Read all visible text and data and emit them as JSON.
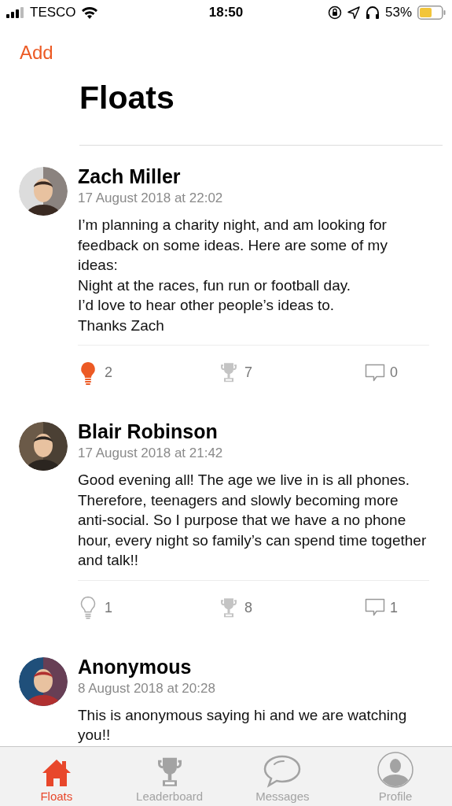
{
  "status_bar": {
    "carrier": "TESCO",
    "time": "18:50",
    "battery": "53%"
  },
  "nav": {
    "add": "Add"
  },
  "title": "Floats",
  "posts": [
    {
      "name": "Zach Miller",
      "date": "17 August 2018 at 22:02",
      "text": "I’m planning a charity night, and am looking for feedback on some ideas. Here are some of my ideas:\nNight at the races, fun run or football day.\nI’d love to hear other people’s ideas to.\nThanks Zach",
      "liked": true,
      "likes": "2",
      "trophies": "7",
      "comments": "0"
    },
    {
      "name": "Blair Robinson",
      "date": "17 August 2018 at 21:42",
      "text": "Good evening all! The age we live in is all phones. Therefore, teenagers and slowly becoming more anti-social. So I purpose that we have a no phone hour, every night so family’s can spend time together and talk!!",
      "liked": false,
      "likes": "1",
      "trophies": "8",
      "comments": "1"
    },
    {
      "name": "Anonymous",
      "date": "8 August 2018 at 20:28",
      "text": "This is anonymous saying hi and we are watching you!!"
    }
  ],
  "tabs": [
    {
      "kind": "home",
      "label": "Floats",
      "selected": true
    },
    {
      "kind": "trophy",
      "label": "Leaderboard",
      "selected": false
    },
    {
      "kind": "chat",
      "label": "Messages",
      "selected": false
    },
    {
      "kind": "profile",
      "label": "Profile",
      "selected": false
    }
  ]
}
